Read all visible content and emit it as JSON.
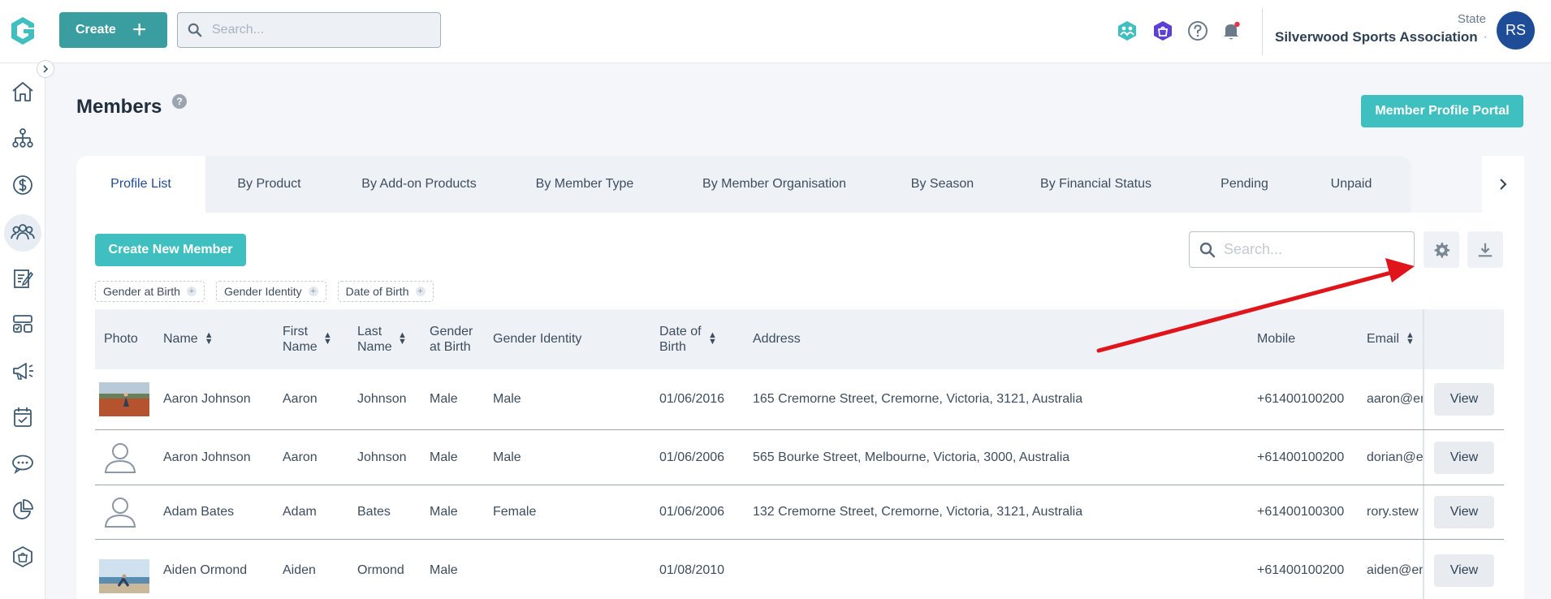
{
  "header": {
    "create_label": "Create",
    "search_placeholder": "Search...",
    "state_label": "State",
    "organisation": "Silverwood Sports Association",
    "avatar_initials": "RS"
  },
  "page": {
    "title": "Members",
    "help_glyph": "?",
    "portal_button": "Member Profile Portal"
  },
  "tabs": [
    {
      "label": "Profile List",
      "active": true
    },
    {
      "label": "By Product"
    },
    {
      "label": "By Add-on Products"
    },
    {
      "label": "By Member Type"
    },
    {
      "label": "By Member Organisation"
    },
    {
      "label": "By Season"
    },
    {
      "label": "By Financial Status"
    },
    {
      "label": "Pending"
    },
    {
      "label": "Unpaid"
    }
  ],
  "toolbar": {
    "create_member": "Create New Member",
    "search_placeholder": "Search..."
  },
  "filter_chips": [
    "Gender at Birth",
    "Gender Identity",
    "Date of Birth"
  ],
  "columns": {
    "photo": "Photo",
    "name": "Name",
    "first_name": "First Name",
    "last_name": "Last Name",
    "gender_birth": "Gender at Birth",
    "gender_identity": "Gender Identity",
    "dob": "Date of Birth",
    "address": "Address",
    "mobile": "Mobile",
    "email": "Email"
  },
  "rows": [
    {
      "photo": "photo",
      "name": "Aaron Johnson",
      "first": "Aaron",
      "last": "Johnson",
      "gender_birth": "Male",
      "gender_identity": "Male",
      "dob": "01/06/2016",
      "address": "165 Cremorne Street, Cremorne, Victoria, 3121, Australia",
      "mobile": "+61400100200",
      "email": "aaron@en",
      "action": "View"
    },
    {
      "photo": "placeholder",
      "name": "Aaron Johnson",
      "first": "Aaron",
      "last": "Johnson",
      "gender_birth": "Male",
      "gender_identity": "Male",
      "dob": "01/06/2006",
      "address": "565 Bourke Street, Melbourne, Victoria, 3000, Australia",
      "mobile": "+61400100200",
      "email": "dorian@e",
      "action": "View"
    },
    {
      "photo": "placeholder",
      "name": "Adam Bates",
      "first": "Adam",
      "last": "Bates",
      "gender_birth": "Male",
      "gender_identity": "Female",
      "dob": "01/06/2006",
      "address": "132 Cremorne Street, Cremorne, Victoria, 3121, Australia",
      "mobile": "+61400100300",
      "email": "rory.stew",
      "action": "View"
    },
    {
      "photo": "photo",
      "name": "Aiden Ormond",
      "first": "Aiden",
      "last": "Ormond",
      "gender_birth": "Male",
      "gender_identity": "",
      "dob": "01/08/2010",
      "address": "",
      "mobile": "+61400100200",
      "email": "aiden@en",
      "action": "View"
    }
  ],
  "colors": {
    "primary": "#3a9ea0",
    "accent": "#3fbfbf",
    "avatar": "#1f4c96",
    "annotation_arrow": "#e0141b"
  }
}
